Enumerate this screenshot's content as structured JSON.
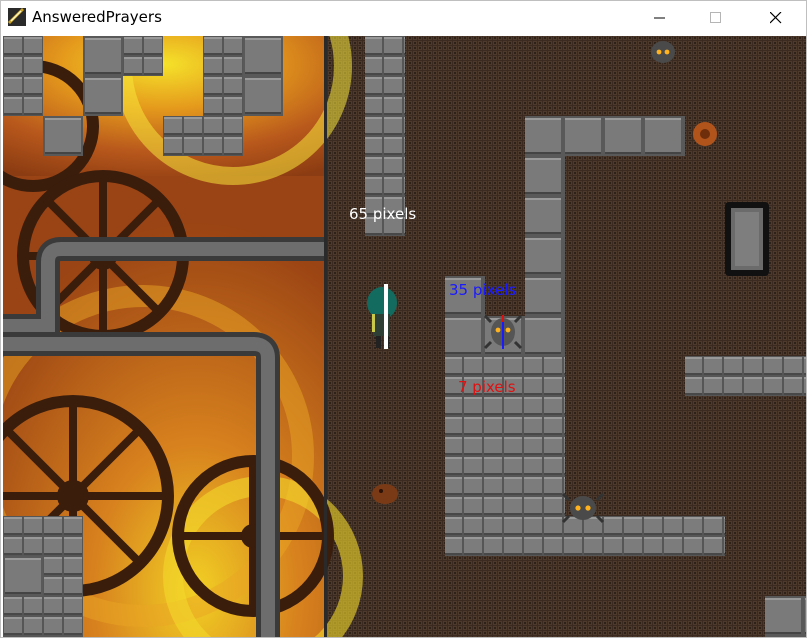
{
  "window": {
    "title": "AnsweredPrayers",
    "controls": [
      "minimize",
      "maximize",
      "close"
    ]
  },
  "annotations": {
    "height_label": "65 pixels",
    "width_label": "35 pixels",
    "offset_label": "7 pixels",
    "height_color": "#ffffff",
    "width_color": "#1a1aff",
    "offset_color": "#e01010"
  },
  "icons": [
    "app-icon",
    "minimize-icon",
    "maximize-icon",
    "close-icon",
    "player-character",
    "spider-enemy",
    "crawler-enemy",
    "gear-icon",
    "doorway-exit"
  ]
}
